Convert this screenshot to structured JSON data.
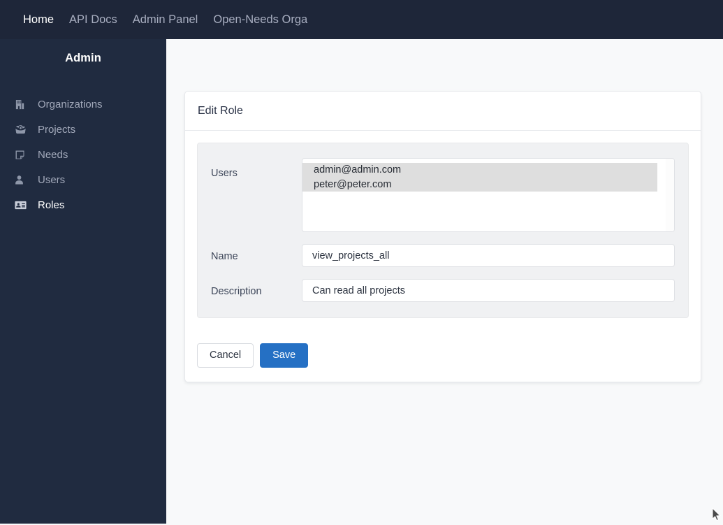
{
  "navbar": {
    "items": [
      {
        "label": "Home",
        "active": true
      },
      {
        "label": "API Docs",
        "active": false
      },
      {
        "label": "Admin Panel",
        "active": false
      },
      {
        "label": "Open-Needs Orga",
        "active": false
      }
    ]
  },
  "sidebar": {
    "brand": "Admin",
    "items": [
      {
        "label": "Organizations",
        "icon": "building-icon",
        "active": false
      },
      {
        "label": "Projects",
        "icon": "projects-icon",
        "active": false
      },
      {
        "label": "Needs",
        "icon": "note-icon",
        "active": false
      },
      {
        "label": "Users",
        "icon": "user-icon",
        "active": false
      },
      {
        "label": "Roles",
        "icon": "id-card-icon",
        "active": true
      }
    ]
  },
  "card": {
    "title": "Edit Role",
    "form": {
      "users": {
        "label": "Users",
        "options": [
          {
            "value": "admin@admin.com",
            "selected": true
          },
          {
            "value": "peter@peter.com",
            "selected": true
          }
        ]
      },
      "name": {
        "label": "Name",
        "value": "view_projects_all",
        "placeholder": "Name"
      },
      "description": {
        "label": "Description",
        "value": "Can read all projects",
        "placeholder": "Description"
      }
    },
    "actions": {
      "cancel_label": "Cancel",
      "save_label": "Save"
    }
  },
  "colors": {
    "navbar_bg": "#1e2639",
    "sidebar_bg": "#202b40",
    "page_bg": "#f8f9fa",
    "panel_bg": "#f0f1f3",
    "primary": "#2570c4",
    "selection": "#dedede"
  }
}
